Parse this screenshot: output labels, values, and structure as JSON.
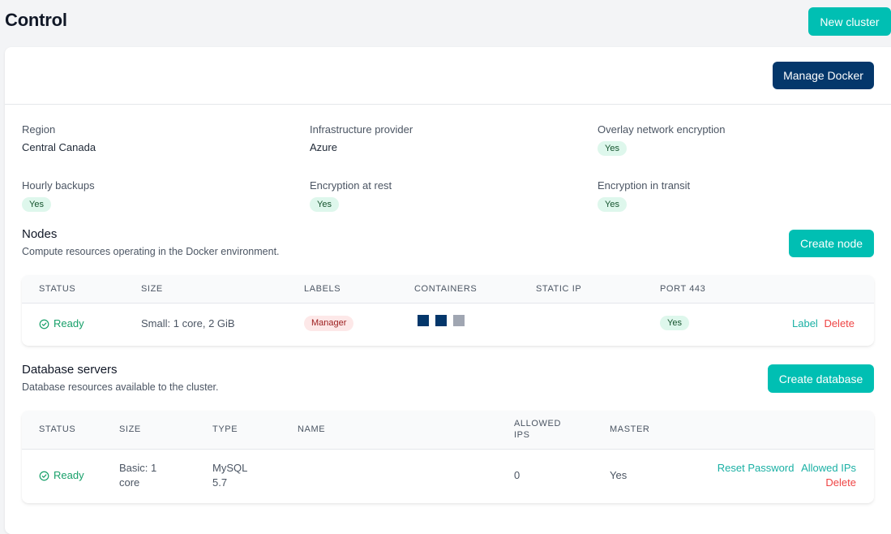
{
  "header": {
    "title": "Control",
    "new_cluster_label": "New cluster"
  },
  "card": {
    "manage_docker_label": "Manage Docker"
  },
  "info": {
    "region": {
      "label": "Region",
      "value": "Central Canada"
    },
    "provider": {
      "label": "Infrastructure provider",
      "value": "Azure"
    },
    "overlay_encryption": {
      "label": "Overlay network encryption",
      "value": "Yes"
    },
    "hourly_backups": {
      "label": "Hourly backups",
      "value": "Yes"
    },
    "encryption_at_rest": {
      "label": "Encryption at rest",
      "value": "Yes"
    },
    "encryption_in_transit": {
      "label": "Encryption in transit",
      "value": "Yes"
    }
  },
  "nodes": {
    "title": "Nodes",
    "description": "Compute resources operating in the Docker environment.",
    "create_label": "Create node",
    "columns": [
      "STATUS",
      "SIZE",
      "LABELS",
      "CONTAINERS",
      "STATIC IP",
      "PORT 443"
    ],
    "rows": [
      {
        "status": "Ready",
        "size": "Small: 1 core, 2 GiB",
        "label": "Manager",
        "containers": [
          "active",
          "active",
          "idle"
        ],
        "static_ip": "",
        "port_443": "Yes",
        "actions": {
          "label": "Label",
          "delete": "Delete"
        }
      }
    ]
  },
  "databases": {
    "title": "Database servers",
    "description": "Database resources available to the cluster.",
    "create_label": "Create database",
    "columns": [
      "STATUS",
      "SIZE",
      "TYPE",
      "NAME",
      "ALLOWED IPS",
      "MASTER"
    ],
    "rows": [
      {
        "status": "Ready",
        "size_line1": "Basic: 1",
        "size_line2": "core",
        "type_line1": "MySQL",
        "type_line2": "5.7",
        "name": "",
        "allowed_ips": "0",
        "master": "Yes",
        "actions": {
          "reset_password": "Reset Password",
          "allowed_ips": "Allowed IPs",
          "delete": "Delete"
        }
      }
    ]
  },
  "colors": {
    "accent_teal": "#00bfb3",
    "navy": "#04376b",
    "success": "#18a06a",
    "danger": "#ef4444"
  }
}
